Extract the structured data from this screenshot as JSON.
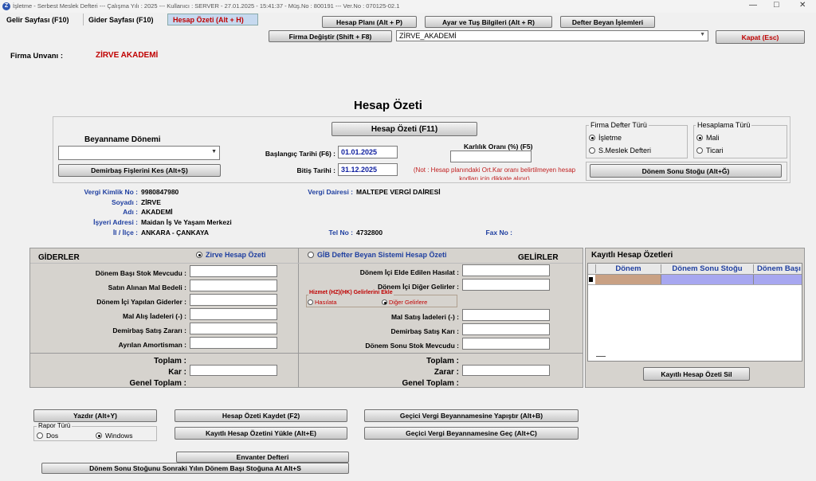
{
  "titlebar": {
    "text": "İşletme - Serbest Meslek Defteri  ---  Çalışma Yılı : 2025  ---  Kullanıcı : SERVER - 27.01.2025 - 15:41:37  -  Müş.No : 800191  ---  Ver.No : 070125-02.1",
    "minimize": "—",
    "maximize": "□",
    "close": "✕"
  },
  "tabs": [
    "Gelir Sayfası (F10)",
    "Gider Sayfası (F10)",
    "Hesap Özeti (Alt + H)"
  ],
  "top_buttons": {
    "hesap_plani": "Hesap Planı (Alt + P)",
    "ayar": "Ayar ve Tuş Bilgileri (Alt + R)",
    "defter_beyan": "Defter Beyan İşlemleri",
    "firma_degistir": "Firma Değiştir (Shift + F8)",
    "kapat": "Kapat (Esc)"
  },
  "firma_combo": "ZİRVE_AKADEMİ",
  "firma_unvani_label": "Firma Unvanı :",
  "firma_unvani": "ZİRVE AKADEMİ",
  "page_title": "Hesap Özeti",
  "beyanname": {
    "label": "Beyanname Dönemi",
    "demirbas_btn": "Demirbaş Fişlerini Kes (Alt+Ş)",
    "hesap_ozeti_btn": "Hesap Özeti (F11)",
    "baslangic_label": "Başlangıç Tarihi (F6) :",
    "baslangic": "01.01.2025",
    "bitis_label": "Bitiş Tarihi :",
    "bitis": "31.12.2025",
    "karlilik_label": "Karlılık Oranı (%) (F5)",
    "note": "(Not : Hesap planındaki Ort.Kar oranı belirtilmeyen hesap kodları için dikkate alınır)"
  },
  "firma_defter": {
    "title": "Firma Defter Türü",
    "opt1": "İşletme",
    "opt2": "S.Meslek Defteri"
  },
  "hesaplama": {
    "title": "Hesaplama Türü",
    "opt1": "Mali",
    "opt2": "Ticari"
  },
  "donem_sonu_btn": "Dönem Sonu Stoğu (Alt+Ğ)",
  "info": {
    "vkn_label": "Vergi Kimlik No :",
    "vkn": "9980847980",
    "soyadi_label": "Soyadı :",
    "soyadi": "ZİRVE",
    "adi_label": "Adı :",
    "adi": "AKADEMİ",
    "isyeri_label": "İşyeri Adresi :",
    "isyeri": "Maidan İş Ve Yaşam Merkezi",
    "il_label": "İl / İlçe :",
    "il": "ANKARA - ÇANKAYA",
    "vd_label": "Vergi Dairesi :",
    "vd": "MALTEPE VERGİ DAİRESİ",
    "tel_label": "Tel No :",
    "tel": "4732800",
    "fax_label": "Fax No :",
    "fax": ""
  },
  "giderler": {
    "title": "GİDERLER",
    "radio": "Zirve Hesap Özeti",
    "rows": [
      "Dönem Başı Stok Mevcudu :",
      "Satın Alınan Mal Bedeli :",
      "Dönem İçi Yapılan Giderler :",
      "Mal Alış İadeleri (-) :",
      "Demirbaş Satış Zararı :",
      "Ayrılan Amortisman :"
    ],
    "toplam": "Toplam :",
    "kar": "Kar :",
    "genel": "Genel Toplam :"
  },
  "gelirler": {
    "title": "GELİRLER",
    "radio": "GİB Defter Beyan Sistemi Hesap Özeti",
    "row1": "Dönem İçi Elde Edilen Hasılat :",
    "row2": "Dönem İçi Diğer Gelirler :",
    "hizmet_title": "Hizmet (HZ)(HK) Gelirlerini Ekle",
    "hasilata": "Hasılata",
    "diger": "Diğer Gelirlere",
    "row3": "Mal Satış İadeleri (-) :",
    "row4": "Demirbaş Satış Karı :",
    "row5": "Dönem Sonu Stok Mevcudu :",
    "toplam": "Toplam :",
    "zarar": "Zarar :",
    "genel": "Genel Toplam :"
  },
  "kayitli": {
    "title": "Kayıtlı Hesap Özetleri",
    "columns": [
      "Dönem",
      "Dönem Sonu Stoğu",
      "Dönem Başı"
    ],
    "sil_btn": "Kayıtlı Hesap Özeti Sil"
  },
  "bottom": {
    "yazdir": "Yazdır (Alt+Y)",
    "rapor_turu": "Rapor Türü",
    "dos": "Dos",
    "windows": "Windows",
    "kaydet": "Hesap Özeti Kaydet (F2)",
    "yukle": "Kayıtlı Hesap Özetini Yükle (Alt+E)",
    "gecici_yapistir": "Geçici Vergi Beyannamesine Yapıştır (Alt+B)",
    "gecici_gec": "Geçici Vergi Beyannamesine Geç (Alt+C)",
    "envanter": "Envanter Defteri",
    "donem_sonu_at": "Dönem Sonu Stoğunu Sonraki Yılın Dönem Başı Stoğuna At Alt+S"
  },
  "colors": {
    "accent_tab": "#c6d9ef",
    "red": "#c00000",
    "blue_label": "#1f3fa0",
    "grid_row": "#c9a184",
    "grid_cell": "#a7a7f0"
  }
}
